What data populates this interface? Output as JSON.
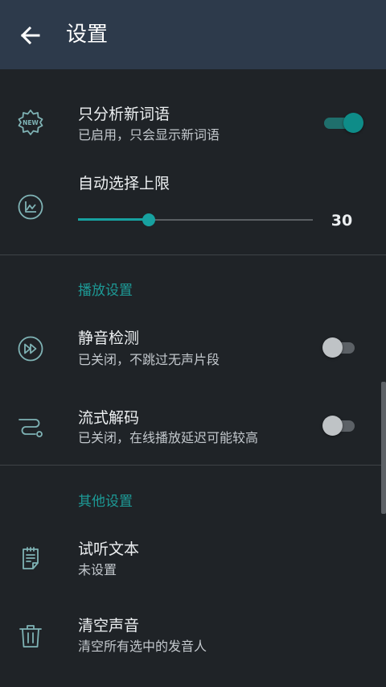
{
  "app_bar": {
    "title": "设置",
    "back_icon": "arrow-back-icon"
  },
  "settings": {
    "new_words_only": {
      "title": "只分析新词语",
      "subtitle": "已启用，只会显示新词语",
      "enabled": true,
      "icon": "new-badge-icon"
    },
    "auto_select_limit": {
      "title": "自动选择上限",
      "value": "30",
      "fill_fraction": 0.3,
      "icon": "chart-icon"
    }
  },
  "playback": {
    "header": "播放设置",
    "silence_detection": {
      "title": "静音检测",
      "subtitle": "已关闭，不跳过无声片段",
      "enabled": false,
      "icon": "fast-forward-icon"
    },
    "streaming_decode": {
      "title": "流式解码",
      "subtitle": "已关闭，在线播放延迟可能较高",
      "enabled": false,
      "icon": "route-icon"
    }
  },
  "other": {
    "header": "其他设置",
    "preview_text": {
      "title": "试听文本",
      "subtitle": "未设置",
      "icon": "clipboard-icon"
    },
    "clear_voices": {
      "title": "清空声音",
      "subtitle": "清空所有选中的发音人",
      "icon": "trash-icon"
    }
  },
  "colors": {
    "app_bar": "#2d3a4b",
    "background": "#1f2327",
    "accent": "#17a1a0",
    "icon": "#7fb3b5"
  }
}
